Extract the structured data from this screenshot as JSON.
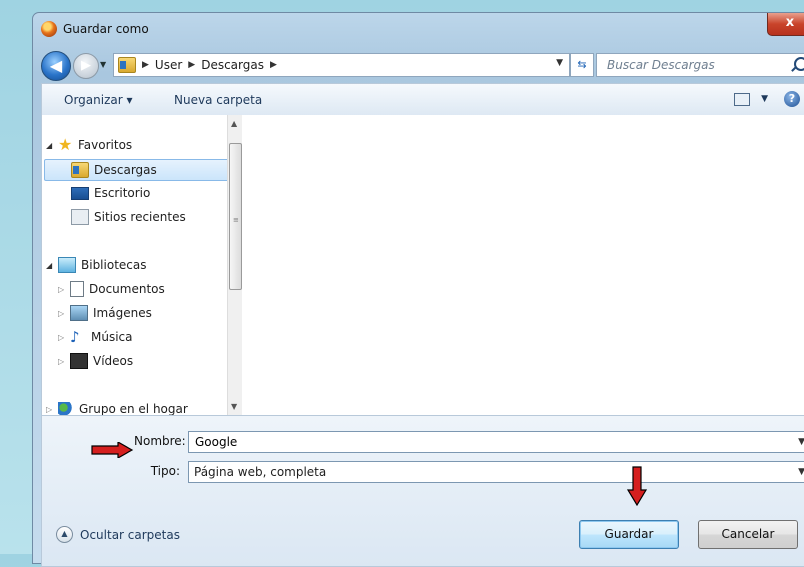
{
  "window": {
    "title": "Guardar como",
    "close_label": "x"
  },
  "address": {
    "breadcrumb": [
      "User",
      "Descargas"
    ]
  },
  "search": {
    "placeholder": "Buscar Descargas"
  },
  "toolbar": {
    "organize_label": "Organizar ▾",
    "new_folder_label": "Nueva carpeta"
  },
  "nav_tree": {
    "favorites": {
      "label": "Favoritos",
      "items": [
        "Descargas",
        "Escritorio",
        "Sitios recientes"
      ]
    },
    "libraries": {
      "label": "Bibliotecas",
      "items": [
        "Documentos",
        "Imágenes",
        "Música",
        "Vídeos"
      ]
    },
    "homegroup": {
      "label": "Grupo en el hogar"
    }
  },
  "form": {
    "name_label": "Nombre:",
    "name_value": "Google",
    "type_label": "Tipo:",
    "type_value": "Página web, completa"
  },
  "footer": {
    "hide_folders_label": "Ocultar carpetas"
  },
  "buttons": {
    "save_label": "Guardar",
    "cancel_label": "Cancelar"
  },
  "colors": {
    "annotation_arrow": "#d51f1f",
    "accent": "#3c7fb1"
  }
}
